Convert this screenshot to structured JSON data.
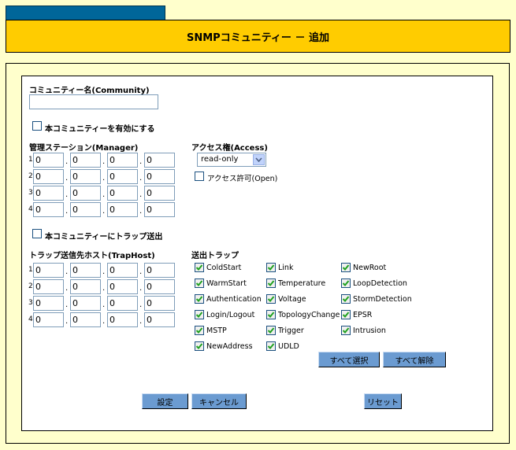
{
  "header": {
    "title": "SNMPコミュニティー － 追加"
  },
  "community": {
    "label": "コミュニティー名(Community)",
    "value": ""
  },
  "enable": {
    "label": "本コミュニティーを有効にする",
    "checked": false
  },
  "manager": {
    "label": "管理ステーション(Manager)",
    "rows": [
      {
        "index": "1",
        "octets": [
          "0",
          "0",
          "0",
          "0"
        ]
      },
      {
        "index": "2",
        "octets": [
          "0",
          "0",
          "0",
          "0"
        ]
      },
      {
        "index": "3",
        "octets": [
          "0",
          "0",
          "0",
          "0"
        ]
      },
      {
        "index": "4",
        "octets": [
          "0",
          "0",
          "0",
          "0"
        ]
      }
    ]
  },
  "access": {
    "label": "アクセス権(Access)",
    "selected": "read-only",
    "open_label": "アクセス許可(Open)",
    "open_checked": false
  },
  "trap_enable": {
    "label": "本コミュニティーにトラップ送出",
    "checked": false
  },
  "traphost": {
    "label": "トラップ送信先ホスト(TrapHost)",
    "rows": [
      {
        "index": "1",
        "octets": [
          "0",
          "0",
          "0",
          "0"
        ]
      },
      {
        "index": "2",
        "octets": [
          "0",
          "0",
          "0",
          "0"
        ]
      },
      {
        "index": "3",
        "octets": [
          "0",
          "0",
          "0",
          "0"
        ]
      },
      {
        "index": "4",
        "octets": [
          "0",
          "0",
          "0",
          "0"
        ]
      }
    ]
  },
  "traps": {
    "label": "送出トラップ",
    "items": [
      {
        "label": "ColdStart",
        "checked": true
      },
      {
        "label": "Link",
        "checked": true
      },
      {
        "label": "NewRoot",
        "checked": true
      },
      {
        "label": "WarmStart",
        "checked": true
      },
      {
        "label": "Temperature",
        "checked": true
      },
      {
        "label": "LoopDetection",
        "checked": true
      },
      {
        "label": "Authentication",
        "checked": true
      },
      {
        "label": "Voltage",
        "checked": true
      },
      {
        "label": "StormDetection",
        "checked": true
      },
      {
        "label": "Login/Logout",
        "checked": true
      },
      {
        "label": "TopologyChange",
        "checked": true
      },
      {
        "label": "EPSR",
        "checked": true
      },
      {
        "label": "MSTP",
        "checked": true
      },
      {
        "label": "Trigger",
        "checked": true
      },
      {
        "label": "Intrusion",
        "checked": true
      },
      {
        "label": "NewAddress",
        "checked": true
      },
      {
        "label": "UDLD",
        "checked": true
      }
    ],
    "select_all": "すべて選択",
    "clear_all": "すべて解除"
  },
  "buttons": {
    "set": "設定",
    "cancel": "キャンセル",
    "reset": "リセット"
  }
}
